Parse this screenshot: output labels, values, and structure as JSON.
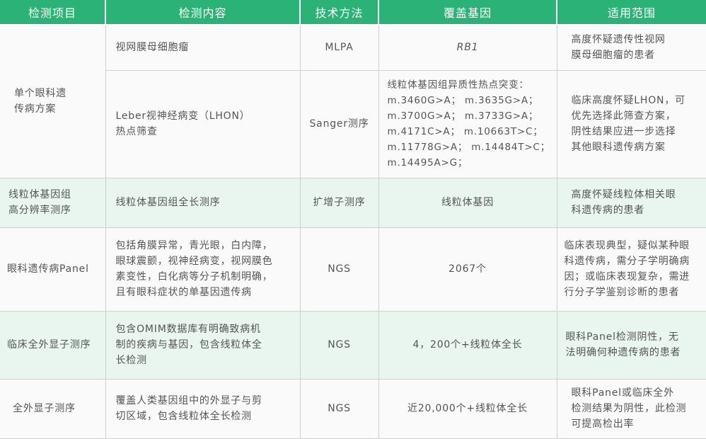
{
  "headers": [
    "检测项目",
    "检测内容",
    "技术方法",
    "覆盖基因",
    "适用范围"
  ],
  "rows": [
    {
      "item": "单个眼科遗传病方案",
      "item_lines": [
        "单个眼科遗",
        "传病方案"
      ],
      "sub": [
        {
          "content_lines": [
            "视网膜母细胞瘤"
          ],
          "method": "MLPA",
          "genes_lines": [
            "RB1"
          ],
          "scope_lines": [
            "高度怀疑遗传性视网",
            "膜母细胞瘤的患者"
          ]
        },
        {
          "content_lines": [
            "Leber视神经病变（LHON）",
            "热点筛查"
          ],
          "method": "Sanger测序",
          "genes_lines": [
            "线粒体基因组异质性热点突变：",
            "m.3460G>A； m.3635G>A；",
            "m.3700G>A； m.3733G>A；",
            "m.4171C>A； m.10663T>C；",
            "m.11778G>A； m.14484T>C；",
            "m.14495A>G；"
          ],
          "scope_lines": [
            "临床高度怀疑LHON，可",
            "优先选择此筛查方案，",
            "阴性结果应进一步选择",
            "其他眼科遗传病方案"
          ]
        }
      ]
    },
    {
      "item_lines": [
        "线粒体基因组",
        "高分辨率测序"
      ],
      "content_lines": [
        "线粒体基因组全长测序"
      ],
      "method": "扩增子测序",
      "genes_lines": [
        "线粒体基因"
      ],
      "scope_lines": [
        "高度怀疑线粒体相关眼",
        "科遗传病的患者"
      ]
    },
    {
      "item_lines": [
        "眼科遗传病Panel"
      ],
      "content_lines": [
        "包括角膜异常，青光眼，白内障，",
        "眼球震颤，视神经病变，视网膜色",
        "素变性，白化病等分子机制明确，",
        "且有眼科症状的单基因遗传病"
      ],
      "method": "NGS",
      "genes_lines": [
        "2067个"
      ],
      "scope_lines": [
        "临床表现典型，疑似某种眼",
        "科遗传病，需分子学明确病",
        "因；或临床表现复杂，需进",
        "行分子学鉴别诊断的患者"
      ]
    },
    {
      "item_lines": [
        "临床全外显子测序"
      ],
      "content_lines": [
        "包含OMIM数据库有明确致病机",
        "制的疾病与基因，包含线粒体全",
        "长检测"
      ],
      "method": "NGS",
      "genes_lines": [
        "4，200个+线粒体全长"
      ],
      "scope_lines": [
        "眼科Panel检测阴性，无",
        "法明确何种遗传病的患者"
      ]
    },
    {
      "item_lines": [
        "全外显子测序"
      ],
      "content_lines": [
        "覆盖人类基因组中的外显子与剪",
        "切区域，包含线粒体全长检测"
      ],
      "method": "NGS",
      "genes_lines": [
        "近20,000个+线粒体全长"
      ],
      "scope_lines": [
        "眼科Panel或临床全外",
        "检测结果为阴性，此检测",
        "可提高检出率"
      ]
    }
  ],
  "colors": {
    "header_bg": "#2bb276",
    "header_text": "#ffffff",
    "row_white": "#fafafa",
    "row_green": "#e8f6ef",
    "text": "#555555",
    "border": "#cfcfcf"
  }
}
